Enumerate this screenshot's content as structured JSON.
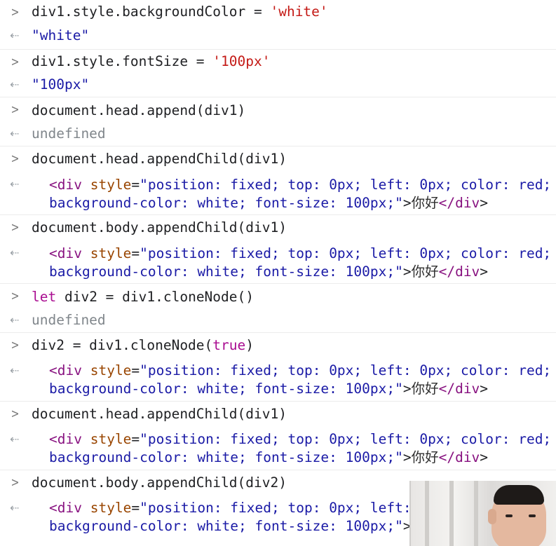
{
  "entries": [
    {
      "input": "div1.style.backgroundColor = 'white'",
      "output": "\"white\""
    },
    {
      "input": "div1.style.fontSize = '100px'",
      "output": "\"100px\""
    },
    {
      "input": "document.head.append(div1)",
      "output": "undefined"
    },
    {
      "input": "document.head.appendChild(div1)",
      "output_line1": "<div style=\"position: fixed; top: 0px; left: 0px; color: red;",
      "output_line2": "background-color: white; font-size: 100px;\">你好</div>"
    },
    {
      "input": "document.body.appendChild(div1)",
      "output_line1": "<div style=\"position: fixed; top: 0px; left: 0px; color: red;",
      "output_line2": "background-color: white; font-size: 100px;\">你好</div>"
    },
    {
      "input": "let div2 = div1.cloneNode()",
      "output": "undefined"
    },
    {
      "input": "div2 = div1.cloneNode(true)",
      "output_line1": "<div style=\"position: fixed; top: 0px; left: 0px; color: red;",
      "output_line2": "background-color: white; font-size: 100px;\">你好</div>"
    },
    {
      "input": "document.head.appendChild(div1)",
      "output_line1": "<div style=\"position: fixed; top: 0px; left: 0px; color: red;",
      "output_line2": "background-color: white; font-size: 100px;\">你好</div>"
    },
    {
      "input": "document.body.appendChild(div2)",
      "output_line1": "<div style=\"position: fixed; top: 0px; left:",
      "output_line2": "background-color: white; font-size: 100px;\">你"
    }
  ],
  "icons": {
    "input_prompt": "chevron-right-icon",
    "output_marker": "return-arrow-icon"
  },
  "colors": {
    "string": "#c41a16",
    "keyword": "#aa0d91",
    "tag": "#881280",
    "attribute": "#994500",
    "attr_value": "#1a1aa6",
    "undefined": "#80868b"
  }
}
